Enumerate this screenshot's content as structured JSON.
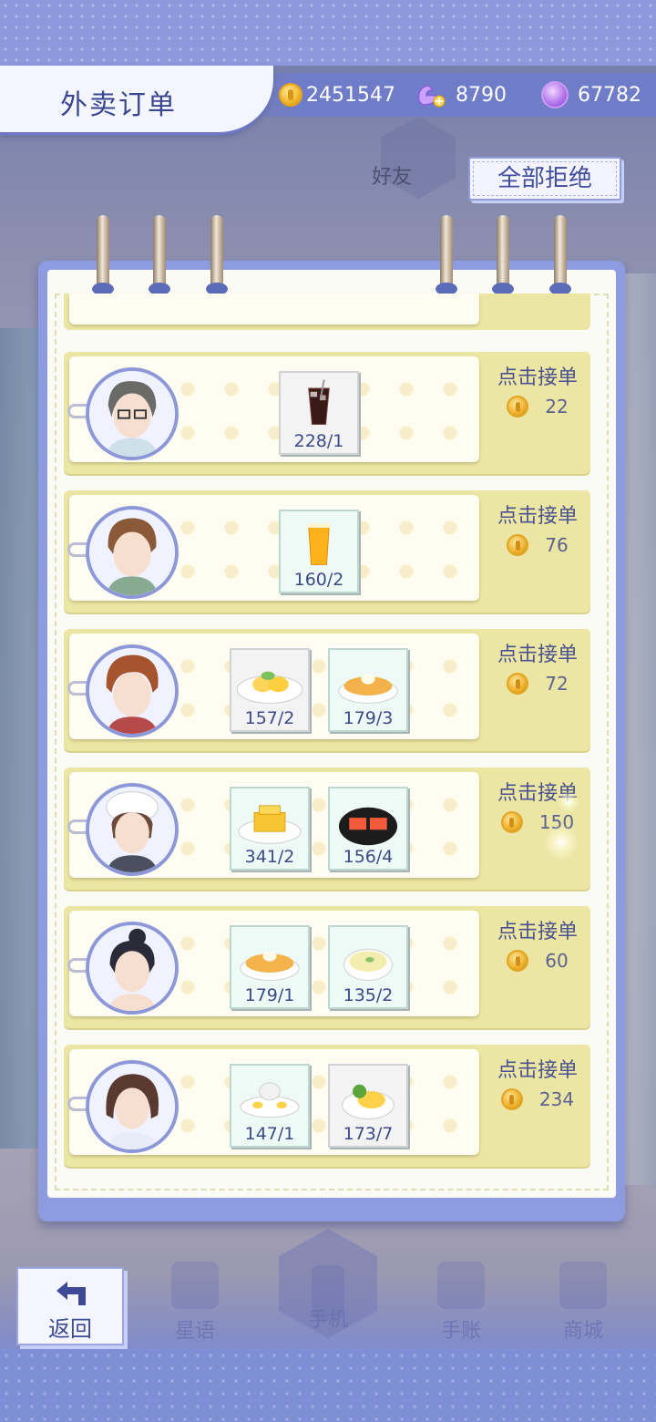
{
  "header": {
    "title": "外卖订单",
    "gold": "2451547",
    "swan": "8790",
    "gems": "67782"
  },
  "reject_all_label": "全部拒绝",
  "friends_label": "好友",
  "orders": [
    {
      "accept_label": "点击接单",
      "reward": "22",
      "foods": [
        {
          "count": "228/1",
          "icon": "iced-cola-icon"
        }
      ]
    },
    {
      "accept_label": "点击接单",
      "reward": "76",
      "foods": [
        {
          "count": "160/2",
          "icon": "orange-juice-icon"
        }
      ]
    },
    {
      "accept_label": "点击接单",
      "reward": "72",
      "foods": [
        {
          "count": "157/2",
          "icon": "mango-dessert-icon"
        },
        {
          "count": "179/3",
          "icon": "pancake-icon"
        }
      ]
    },
    {
      "accept_label": "点击接单",
      "reward": "150",
      "foods": [
        {
          "count": "341/2",
          "icon": "butter-cake-icon"
        },
        {
          "count": "156/4",
          "icon": "salmon-sushi-icon"
        }
      ]
    },
    {
      "accept_label": "点击接单",
      "reward": "60",
      "foods": [
        {
          "count": "179/1",
          "icon": "pancake-icon"
        },
        {
          "count": "135/2",
          "icon": "cream-soup-icon"
        }
      ]
    },
    {
      "accept_label": "点击接单",
      "reward": "234",
      "foods": [
        {
          "count": "147/1",
          "icon": "egg-tart-plate-icon"
        },
        {
          "count": "173/7",
          "icon": "broccoli-salad-icon"
        }
      ]
    }
  ],
  "back_label": "返回",
  "nav": {
    "star": "星语",
    "phone": "手机",
    "journal": "手账",
    "shop": "商城"
  },
  "colors": {
    "accent": "#6f7cc8",
    "row_back": "#ece6a4",
    "text_blue": "#3d4a8a"
  }
}
